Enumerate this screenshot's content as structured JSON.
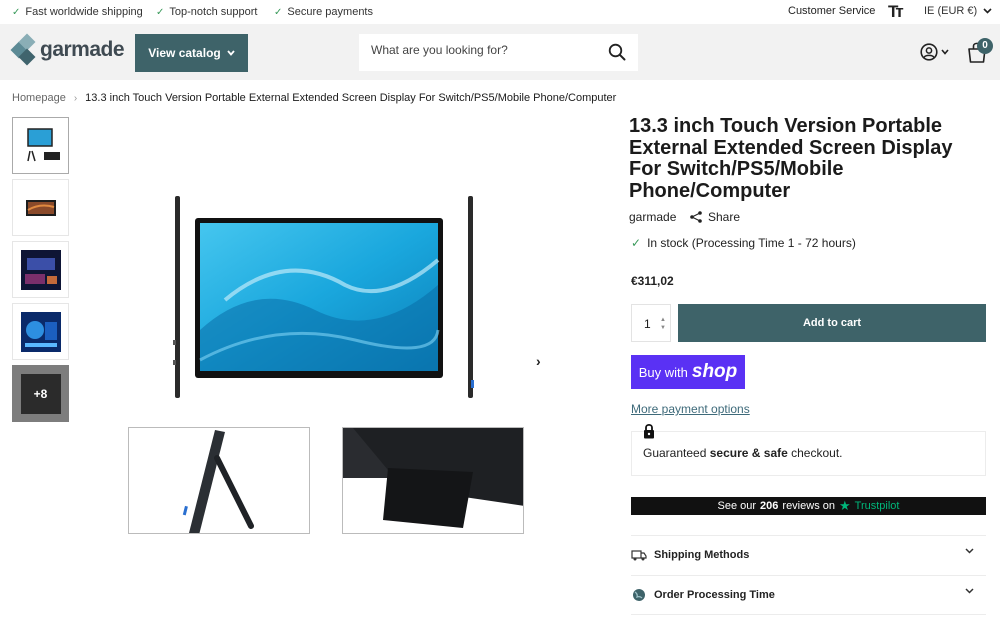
{
  "topbar": {
    "usps": [
      "Fast worldwide shipping",
      "Top-notch support",
      "Secure payments"
    ],
    "customer_service": "Customer Service",
    "text_size_icon": "Tт",
    "currency": "IE (EUR €)"
  },
  "header": {
    "logo_text": "garmade",
    "catalog_button": "View catalog",
    "search_placeholder": "What are you looking for?",
    "cart_count": "0"
  },
  "breadcrumb": {
    "home": "Homepage",
    "current": "13.3 inch Touch Version Portable External Extended Screen Display For Switch/PS5/Mobile Phone/Computer"
  },
  "gallery": {
    "more_count": "+8"
  },
  "product": {
    "title": "13.3 inch Touch Version Portable External Extended Screen Display For Switch/PS5/Mobile Phone/Computer",
    "vendor": "garmade",
    "share_label": "Share",
    "stock_text": "In stock (Processing Time 1 - 72 hours)",
    "price": "€311,02",
    "quantity": "1",
    "add_to_cart": "Add to cart",
    "buy_with": "Buy with",
    "shop": "shop",
    "more_payment": "More payment options",
    "secure_prefix": "Guaranteed",
    "secure_bold": "secure & safe",
    "secure_suffix": "checkout.",
    "trust_prefix": "See our",
    "trust_count": "206",
    "trust_mid": "reviews on",
    "trust_brand": "Trustpilot"
  },
  "accordions": [
    {
      "label": "Shipping Methods",
      "icon": "truck-icon"
    },
    {
      "label": "Order Processing Time",
      "icon": "globe-icon"
    }
  ],
  "colors": {
    "accent": "#3e6369",
    "shop_purple": "#5a31f4",
    "check_green": "#3a9a5b",
    "trustpilot_green": "#00b67a"
  }
}
